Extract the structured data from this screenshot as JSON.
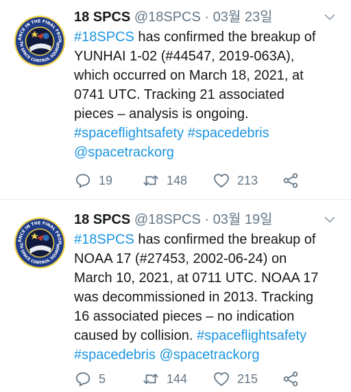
{
  "tweets": [
    {
      "name": "18 SPCS",
      "handle": "@18SPCS",
      "separator": "·",
      "date": "03월 23일",
      "lines": [
        [
          {
            "t": "#18SPCS",
            "link": true
          },
          {
            "t": " has confirmed the  breakup of",
            "link": false
          }
        ],
        [
          {
            "t": "YUNHAI 1-02 (#44547, 2019-063A),",
            "link": false
          }
        ],
        [
          {
            "t": "which occurred on March 18, 2021, at",
            "link": false
          }
        ],
        [
          {
            "t": "0741 UTC. Tracking 21 associated",
            "link": false
          }
        ],
        [
          {
            "t": "pieces – analysis is ongoing.",
            "link": false
          }
        ],
        [
          {
            "t": "#spaceflightsafety",
            "link": true
          },
          {
            "t": " ",
            "link": false
          },
          {
            "t": "#spacedebris",
            "link": true
          }
        ],
        [
          {
            "t": "@spacetrackorg",
            "link": true
          }
        ]
      ],
      "replies": "19",
      "retweets": "148",
      "likes": "213"
    },
    {
      "name": "18 SPCS",
      "handle": "@18SPCS",
      "separator": "·",
      "date": "03월 19일",
      "lines": [
        [
          {
            "t": "#18SPCS",
            "link": true
          },
          {
            "t": " has confirmed the breakup of",
            "link": false
          }
        ],
        [
          {
            "t": "NOAA 17 (#27453, 2002-06-24) on",
            "link": false
          }
        ],
        [
          {
            "t": "March 10, 2021, at 0711 UTC. NOAA 17",
            "link": false
          }
        ],
        [
          {
            "t": "was decommissioned in 2013. Tracking",
            "link": false
          }
        ],
        [
          {
            "t": "16 associated pieces – no indication",
            "link": false
          }
        ],
        [
          {
            "t": "caused by collision. ",
            "link": false
          },
          {
            "t": "#spaceflightsafety",
            "link": true
          }
        ],
        [
          {
            "t": "#spacedebris",
            "link": true
          },
          {
            "t": " ",
            "link": false
          },
          {
            "t": "@spacetrackorg",
            "link": true
          }
        ]
      ],
      "replies": "5",
      "retweets": "144",
      "likes": "215"
    }
  ],
  "avatar_text": {
    "top_arc": "VIGILANCE IN THE FINAL FRONTIER",
    "bottom_arc": "18TH SPACE CONTROL SQUADRON"
  },
  "colors": {
    "link": "#1b95e0",
    "muted": "#657786",
    "text": "#14171a",
    "divider": "#e6ecf0",
    "avatar_ring": "#1f3c88",
    "avatar_field": "#101a3c"
  },
  "icons": {
    "reply": "reply-icon",
    "retweet": "retweet-icon",
    "like": "heart-icon",
    "share": "share-icon",
    "menu": "chevron-down-icon"
  }
}
